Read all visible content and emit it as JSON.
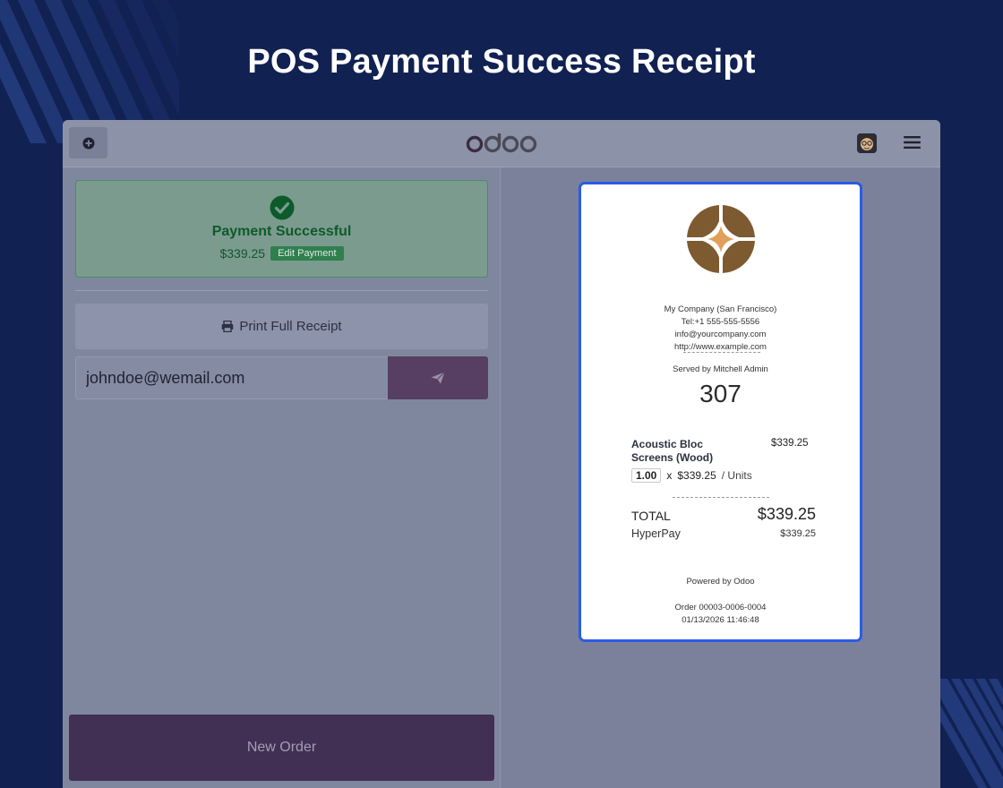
{
  "page": {
    "title": "POS Payment Success Receipt"
  },
  "topbar": {
    "logo_text": "odoo",
    "add_icon": "plus-circle-icon",
    "avatar_icon": "user-avatar-icon",
    "menu_icon": "hamburger-menu-icon"
  },
  "payment": {
    "status_title": "Payment Successful",
    "amount": "$339.25",
    "edit_label": "Edit Payment",
    "status_icon": "check-circle-icon"
  },
  "actions": {
    "print_label": "Print Full Receipt",
    "print_icon": "printer-icon",
    "email_value": "johndoe@wemail.com",
    "send_icon": "paper-plane-icon",
    "new_order_label": "New Order"
  },
  "receipt": {
    "company": "My Company (San Francisco)",
    "tel": "Tel:+1 555-555-5556",
    "email": "info@yourcompany.com",
    "website": "http://www.example.com",
    "served_by": "Served by Mitchell Admin",
    "order_number": "307",
    "lines": [
      {
        "product": "Acoustic Bloc Screens (Wood)",
        "price": "$339.25",
        "qty": "1.00",
        "unit_price": "$339.25",
        "unit": "/ Units"
      }
    ],
    "total_label": "TOTAL",
    "total": "$339.25",
    "payment_method": "HyperPay",
    "payment_amount": "$339.25",
    "powered_by": "Powered by Odoo",
    "order_ref": "Order 00003-0006-0004",
    "datetime": "01/13/2026 11:46:48"
  },
  "colors": {
    "background": "#112152",
    "receipt_border": "#2a5ce6",
    "success_green": "#0f5a2b",
    "odoo_purple": "#563f63",
    "logo_brown": "#7d5a30"
  }
}
